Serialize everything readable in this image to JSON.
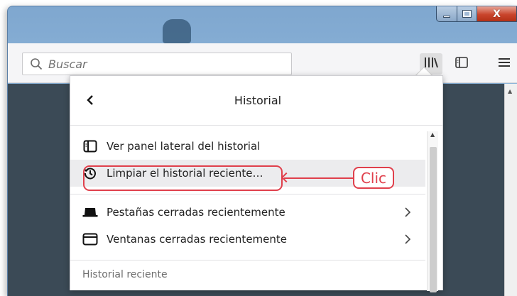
{
  "window": {
    "close_label": "X"
  },
  "toolbar": {
    "search_placeholder": "Buscar"
  },
  "panel": {
    "title": "Historial",
    "items": [
      {
        "label": "Ver panel lateral del historial",
        "icon": "sidebar-icon"
      },
      {
        "label": "Limpiar el historial reciente…",
        "icon": "history-clear-icon"
      },
      {
        "label": "Pestañas cerradas recientemente",
        "icon": "tab-icon",
        "submenu": true
      },
      {
        "label": "Ventanas cerradas recientemente",
        "icon": "window-icon",
        "submenu": true
      }
    ],
    "section_label": "Historial reciente"
  },
  "annotation": {
    "label": "Clic",
    "color": "#e0404c"
  }
}
